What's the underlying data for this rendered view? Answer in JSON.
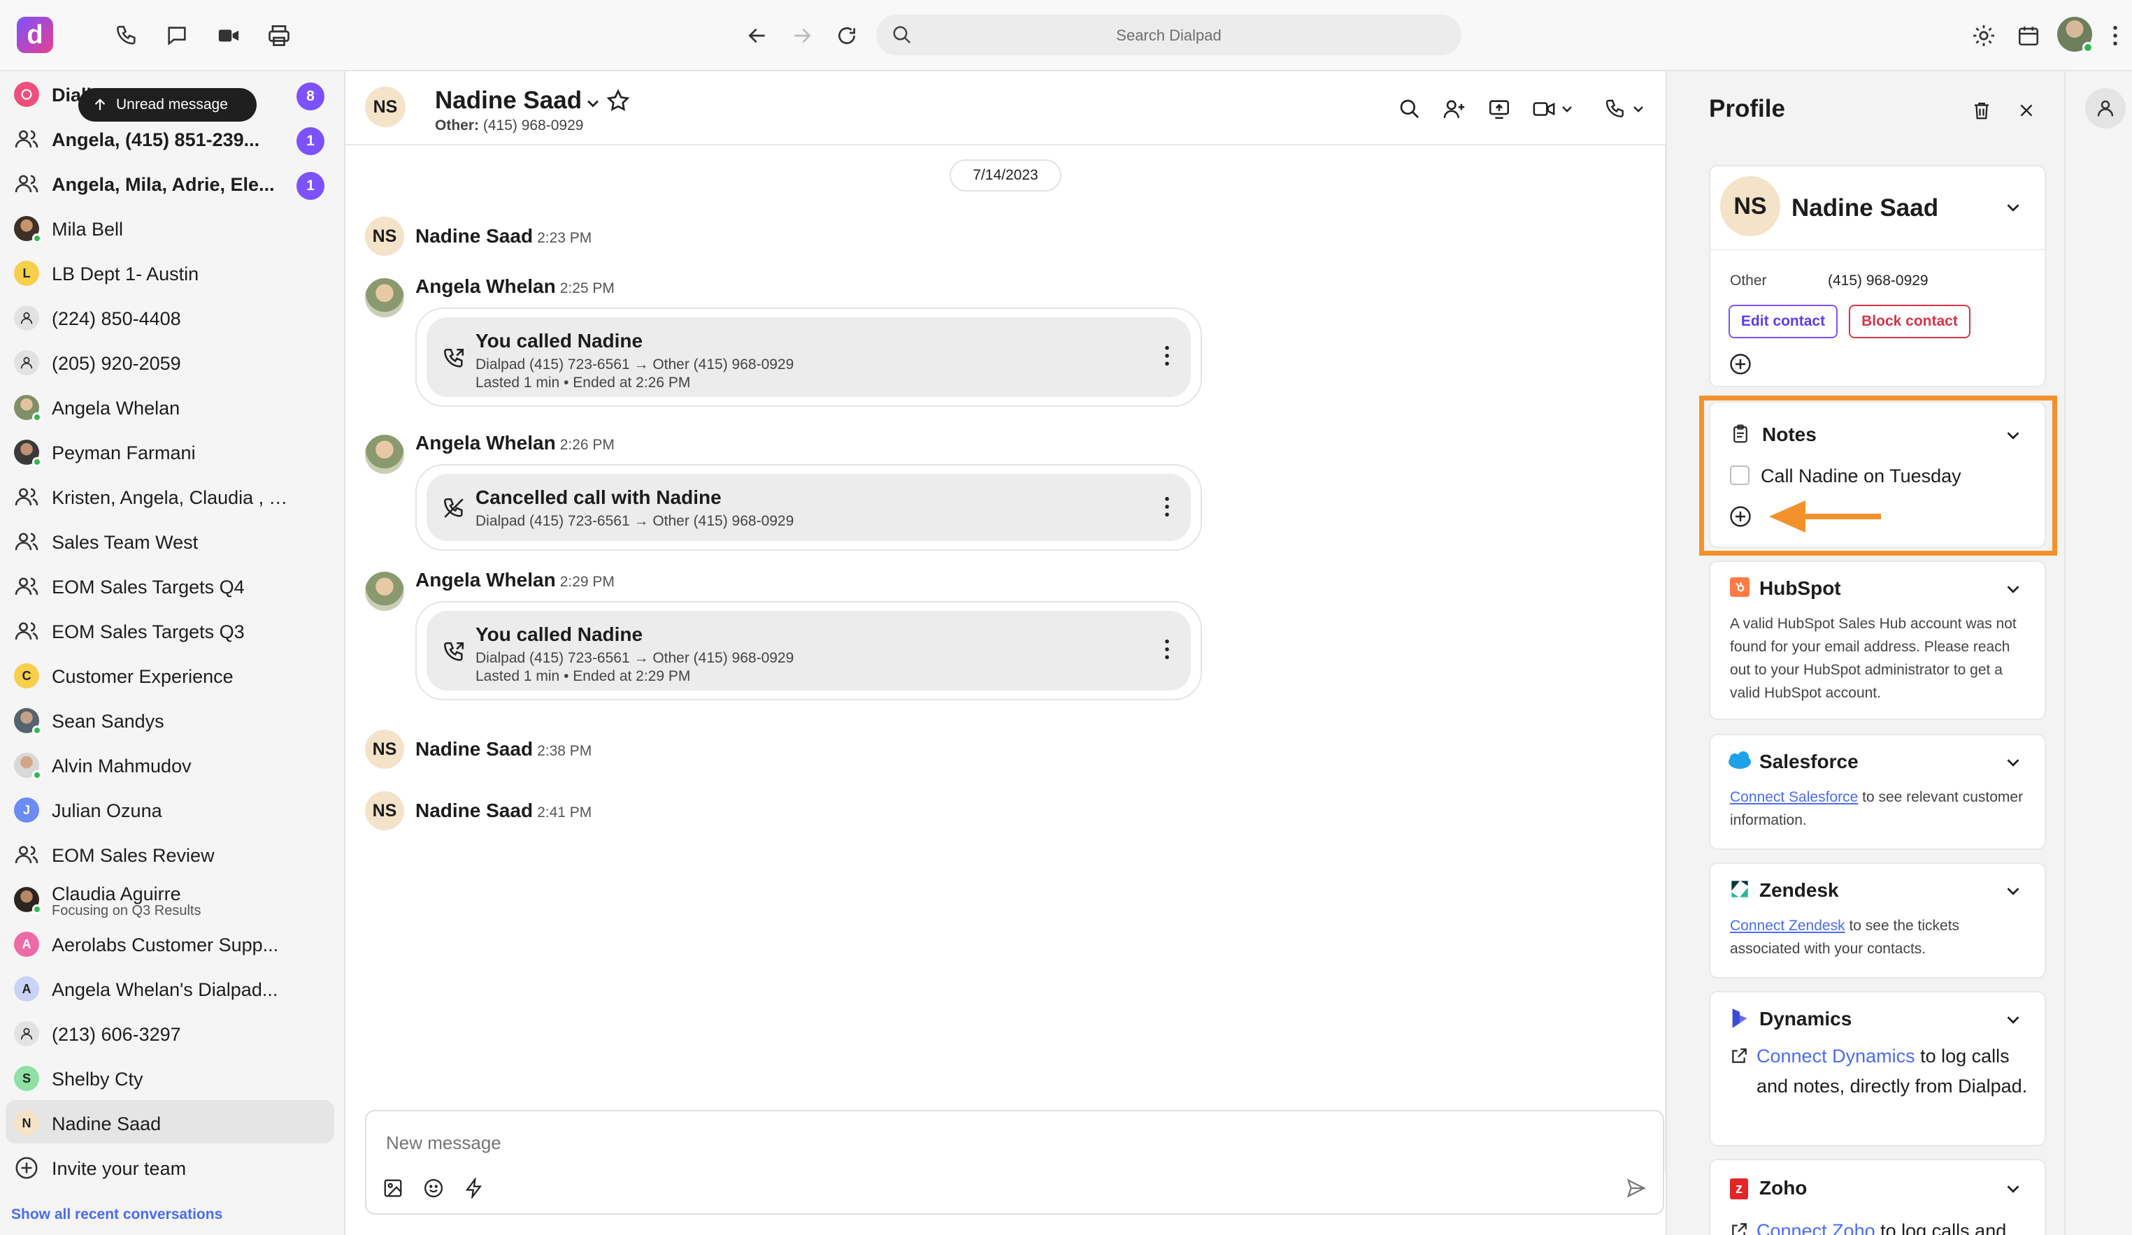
{
  "topbar": {
    "logo_letter": "d",
    "search_placeholder": "Search Dialpad"
  },
  "sidebar": {
    "tooltip": "Unread message",
    "items": [
      {
        "label": "Dialbot",
        "badge": "8"
      },
      {
        "label": "Angela, (415) 851-239...",
        "badge": "1"
      },
      {
        "label": "Angela, Mila, Adrie, Ele...",
        "badge": "1"
      },
      {
        "label": "Mila Bell"
      },
      {
        "label": "LB Dept 1- Austin",
        "letter": "L"
      },
      {
        "label": "(224) 850-4408"
      },
      {
        "label": "(205) 920-2059"
      },
      {
        "label": "Angela Whelan"
      },
      {
        "label": "Peyman Farmani"
      },
      {
        "label": "Kristen, Angela, Claudia , To..."
      },
      {
        "label": "Sales Team West"
      },
      {
        "label": "EOM Sales Targets Q4"
      },
      {
        "label": "EOM Sales Targets Q3"
      },
      {
        "label": "Customer Experience",
        "letter": "C"
      },
      {
        "label": "Sean Sandys"
      },
      {
        "label": "Alvin Mahmudov"
      },
      {
        "label": "Julian Ozuna",
        "letter": "J"
      },
      {
        "label": "EOM Sales Review"
      },
      {
        "label": "Claudia Aguirre",
        "status": "Focusing on Q3 Results"
      },
      {
        "label": "Aerolabs Customer Supp...",
        "letter": "A"
      },
      {
        "label": "Angela Whelan's Dialpad...",
        "letter": "A"
      },
      {
        "label": "(213) 606-3297"
      },
      {
        "label": "Shelby Cty",
        "letter": "S"
      },
      {
        "label": "Nadine Saad",
        "letter": "N"
      },
      {
        "label": "Invite your team"
      }
    ],
    "show_recent": "Show all recent conversations"
  },
  "chat": {
    "header": {
      "initials": "NS",
      "name": "Nadine Saad",
      "sub_label": "Other:",
      "sub_value": "(415) 968-0929"
    },
    "date": "7/14/2023",
    "messages": [
      {
        "initials": "NS",
        "name": "Nadine Saad",
        "time": "2:23 PM"
      },
      {
        "name": "Angela Whelan",
        "time": "2:25 PM",
        "card": {
          "title": "You called Nadine",
          "line1": "Dialpad (415) 723-6561 → Other (415) 968-0929",
          "line2": "Lasted 1 min • Ended at 2:26 PM"
        }
      },
      {
        "name": "Angela Whelan",
        "time": "2:26 PM",
        "card": {
          "title": "Cancelled call with Nadine",
          "line1": "Dialpad (415) 723-6561 → Other (415) 968-0929"
        }
      },
      {
        "name": "Angela Whelan",
        "time": "2:29 PM",
        "card": {
          "title": "You called Nadine",
          "line1": "Dialpad (415) 723-6561 → Other (415) 968-0929",
          "line2": "Lasted 1 min • Ended at 2:29 PM"
        }
      },
      {
        "initials": "NS",
        "name": "Nadine Saad",
        "time": "2:38 PM"
      },
      {
        "initials": "NS",
        "name": "Nadine Saad",
        "time": "2:41 PM"
      }
    ],
    "composer_placeholder": "New message"
  },
  "profile": {
    "title": "Profile",
    "contact": {
      "initials": "NS",
      "name": "Nadine Saad",
      "phone_label": "Other",
      "phone": "(415) 968-0929",
      "edit": "Edit contact",
      "block": "Block contact"
    },
    "notes": {
      "title": "Notes",
      "item": "Call Nadine on Tuesday"
    },
    "hubspot": {
      "title": "HubSpot",
      "text": "A valid HubSpot Sales Hub account was not found for your email address. Please reach out to your HubSpot administrator to get a valid HubSpot account."
    },
    "salesforce": {
      "title": "Salesforce",
      "link": "Connect Salesforce",
      "text": " to see relevant customer information."
    },
    "zendesk": {
      "title": "Zendesk",
      "link": "Connect Zendesk",
      "text": " to see the tickets associated with your contacts."
    },
    "dynamics": {
      "title": "Dynamics",
      "link": "Connect Dynamics",
      "text": " to log calls and notes, directly from Dialpad."
    },
    "zoho": {
      "title": "Zoho",
      "link": "Connect Zoho",
      "text": " to log calls and"
    }
  },
  "colors": {
    "accent": "#7c52ff",
    "highlight": "#f3922c",
    "link": "#4a6cf7",
    "danger": "#d8344a"
  }
}
